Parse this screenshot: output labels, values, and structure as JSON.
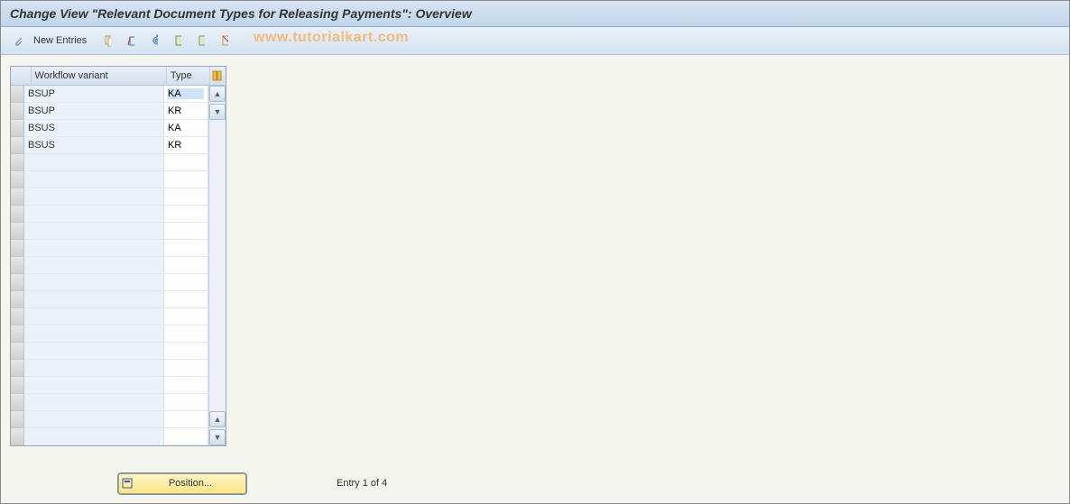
{
  "title": "Change View \"Relevant Document Types for Releasing Payments\": Overview",
  "toolbar": {
    "new_entries_label": "New Entries",
    "icons": {
      "change": "toggle-display-change",
      "copy": "copy-as",
      "delete": "delete",
      "undo": "undo-change",
      "select_all": "select-all",
      "save": "select-block",
      "deselect": "deselect-all"
    }
  },
  "watermark": "www.tutorialkart.com",
  "grid": {
    "columns": [
      "Workflow variant",
      "Type"
    ],
    "rows": [
      {
        "variant": "BSUP",
        "type": "KA"
      },
      {
        "variant": "BSUP",
        "type": "KR"
      },
      {
        "variant": "BSUS",
        "type": "KA"
      },
      {
        "variant": "BSUS",
        "type": "KR"
      }
    ],
    "empty_rows": 17,
    "config_icon": "table-settings"
  },
  "footer": {
    "position_label": "Position...",
    "entry_text": "Entry 1 of 4"
  },
  "colors": {
    "header_grad_top": "#d7e4f2",
    "header_grad_bottom": "#c1d5ea",
    "accent": "#f9e38b"
  }
}
